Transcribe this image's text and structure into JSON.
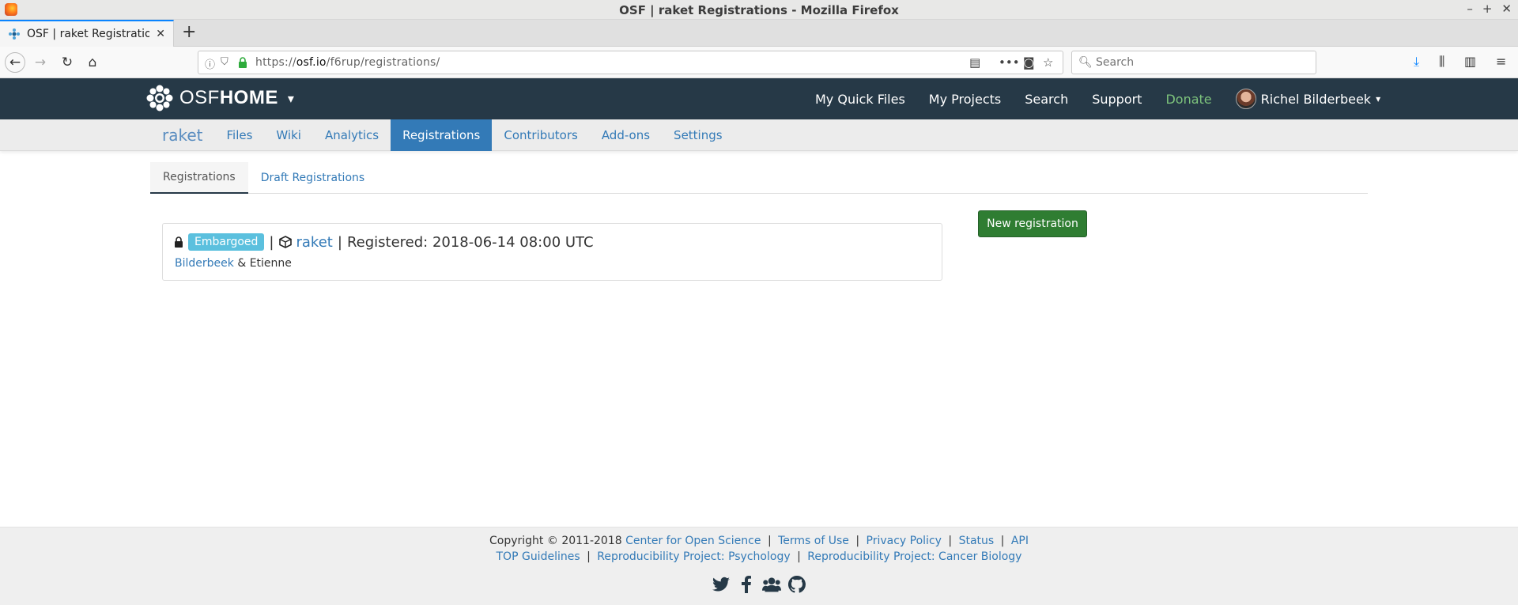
{
  "window": {
    "title": "OSF | raket Registrations - Mozilla Firefox",
    "controls": [
      "–",
      "+",
      "✕"
    ]
  },
  "browser": {
    "tab_title": "OSF | raket Registrations",
    "tab_close": "✕",
    "new_tab": "+",
    "url_domain": "osf.io",
    "url_prefix": "https://",
    "url_path": "/f6rup/registrations/",
    "search_placeholder": "Search",
    "url_more": "•••"
  },
  "osf": {
    "brand_light": "OSF",
    "brand_bold": "HOME",
    "caret": "▾",
    "links": [
      "My Quick Files",
      "My Projects",
      "Search",
      "Support",
      "Donate"
    ],
    "user_name": "Richel Bilderbeek",
    "user_caret": "▾",
    "accent": "#263947"
  },
  "project_nav": {
    "title": "raket",
    "items": [
      "Files",
      "Wiki",
      "Analytics",
      "Registrations",
      "Contributors",
      "Add-ons",
      "Settings"
    ],
    "active": "Registrations"
  },
  "tabs": [
    "Registrations",
    "Draft Registrations"
  ],
  "registration": {
    "status": "Embargoed",
    "sep": "|",
    "project": "raket",
    "registered": "Registered: 2018-06-14 08:00 UTC",
    "author_linked": "Bilderbeek",
    "author_rest": "& Etienne"
  },
  "new_registration_button": "New registration",
  "footer": {
    "copyright": "Copyright © 2011-2018",
    "row1_links": [
      "Center for Open Science",
      "Terms of Use",
      "Privacy Policy",
      "Status",
      "API"
    ],
    "row2_links": [
      "TOP Guidelines",
      "Reproducibility Project: Psychology",
      "Reproducibility Project: Cancer Biology"
    ],
    "social_icons": [
      "twitter-icon",
      "facebook-icon",
      "group-icon",
      "github-icon"
    ]
  }
}
